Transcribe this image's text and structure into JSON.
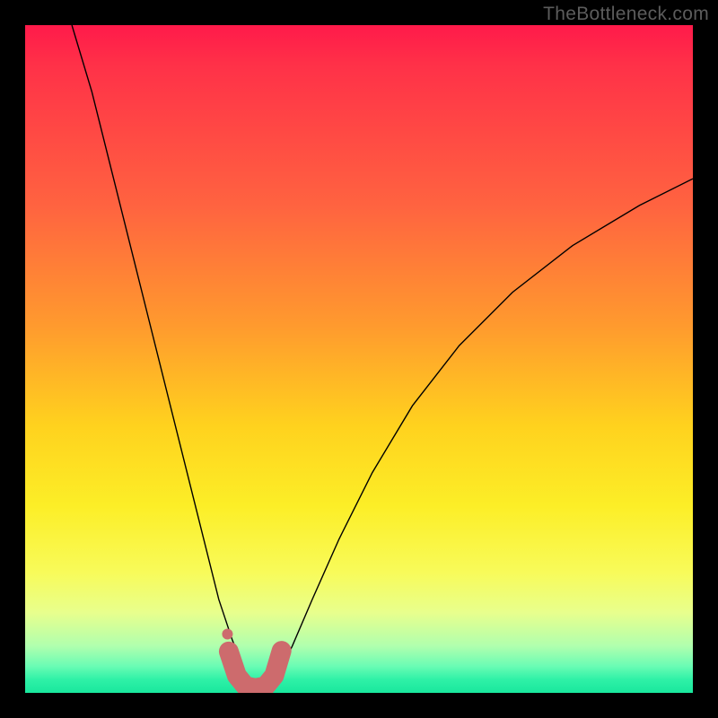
{
  "watermark_text": "TheBottleneck.com",
  "chart_data": {
    "type": "line",
    "title": "",
    "xlabel": "",
    "ylabel": "",
    "xlim": [
      0,
      100
    ],
    "ylim": [
      0,
      100
    ],
    "legend": false,
    "grid": false,
    "background_gradient": {
      "direction": "vertical",
      "stops": [
        {
          "pos": 0.0,
          "color": "#ff1a4a",
          "meaning": "high bottleneck"
        },
        {
          "pos": 0.27,
          "color": "#ff6340"
        },
        {
          "pos": 0.45,
          "color": "#ff9a2e"
        },
        {
          "pos": 0.6,
          "color": "#ffd21e"
        },
        {
          "pos": 0.82,
          "color": "#f8fb5a"
        },
        {
          "pos": 0.93,
          "color": "#b0ffae"
        },
        {
          "pos": 1.0,
          "color": "#19e79d",
          "meaning": "no bottleneck"
        }
      ]
    },
    "series": [
      {
        "name": "bottleneck-curve",
        "stroke": "#000000",
        "stroke_width": 1.4,
        "x": [
          7,
          10,
          13,
          16,
          19,
          22,
          25,
          27,
          29,
          31,
          33,
          34.5,
          36,
          38,
          40,
          43,
          47,
          52,
          58,
          65,
          73,
          82,
          92,
          100
        ],
        "y": [
          100,
          90,
          78,
          66,
          54,
          42,
          30,
          22,
          14,
          8,
          3,
          1,
          1,
          3,
          7,
          14,
          23,
          33,
          43,
          52,
          60,
          67,
          73,
          77
        ]
      },
      {
        "name": "optimal-range-marker",
        "stroke": "#cd6b6d",
        "stroke_width": 10,
        "linecap": "round",
        "x": [
          30.5,
          31.7,
          33.0,
          34.5,
          36.0,
          37.3,
          38.4
        ],
        "y": [
          6.2,
          2.6,
          1.0,
          0.7,
          1.0,
          2.6,
          6.3
        ]
      }
    ],
    "annotations": [
      {
        "type": "dot",
        "x": 30.3,
        "y": 8.8,
        "radius_px": 6,
        "color": "#cd6b6d",
        "name": "marker-dot"
      }
    ]
  }
}
